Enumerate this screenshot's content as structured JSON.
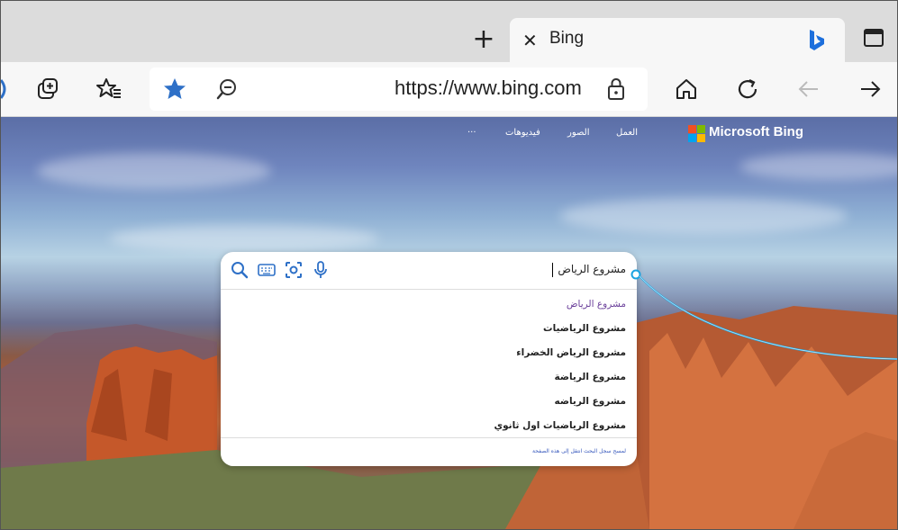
{
  "browser": {
    "tab": {
      "title": "Bing",
      "close_label": "✕"
    },
    "new_tab_label": "+",
    "address": {
      "url": "https://www.bing.com"
    }
  },
  "bing": {
    "brand": "Microsoft Bing",
    "nav": {
      "work": "العمل",
      "images": "الصور",
      "videos": "فيديوهات",
      "more": "···"
    },
    "search": {
      "query": "مشروع الرياض",
      "suggestions": [
        "مشروع الرياض",
        "مشروع الرياضيات",
        "مشروع الرياض الخضراء",
        "مشروع الرياضة",
        "مشروع الرياضه",
        "مشروع الرياضيات اول ثانوي"
      ],
      "footer": "لمسح سجل البحث انتقل إلى هذه الصفحة"
    }
  },
  "colors": {
    "accent": "#2e70c7",
    "callout": "#1aa3e0",
    "suggestion_visited": "#6a3f9a"
  }
}
